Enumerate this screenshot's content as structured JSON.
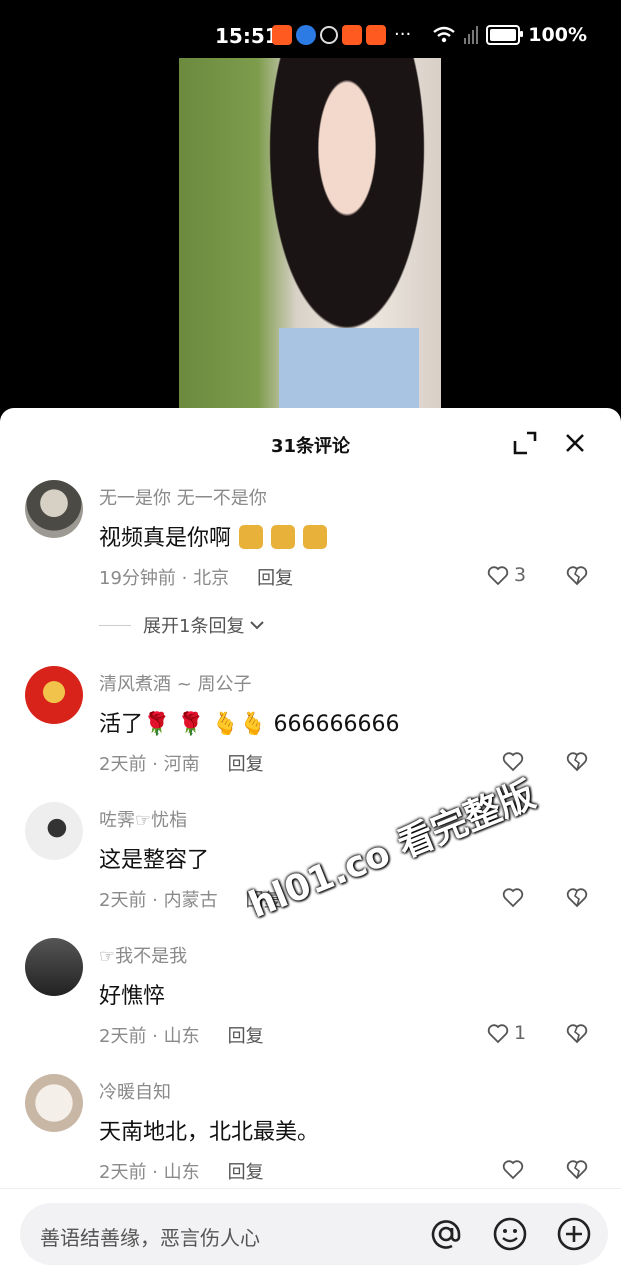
{
  "status_bar": {
    "time": "15:51",
    "more": "···",
    "battery_percent": "100%"
  },
  "panel": {
    "title": "31条评论"
  },
  "comments": [
    {
      "user": "无一是你 无一不是你",
      "text": "视频真是你啊",
      "time": "19分钟前 · 北京",
      "reply_label": "回复",
      "likes": "3",
      "emoji_count": 3
    },
    {
      "user": "清风煮酒 ~ 周公子",
      "text": "活了🌹 🌹 🫰🫰 666666666",
      "time": "2天前 · 河南",
      "reply_label": "回复",
      "likes": ""
    },
    {
      "user": "咗霁☞忧栺",
      "text": "这是整容了",
      "time": "2天前 · 内蒙古",
      "reply_label": "回复",
      "likes": ""
    },
    {
      "user": "☞我不是我",
      "text": "好憔悴",
      "time": "2天前 · 山东",
      "reply_label": "回复",
      "likes": "1"
    },
    {
      "user": "冷暖自知",
      "text": "天南地北，北北最美。",
      "time": "2天前 · 山东",
      "reply_label": "回复",
      "likes": ""
    }
  ],
  "expand_replies": "展开1条回复",
  "watermark": "hl01.co 看完整版",
  "input": {
    "placeholder": "善语结善缘，恶言伤人心"
  },
  "colors": {
    "accent_orange": "#ff5a1f",
    "meta_gray": "#8a8a8a"
  }
}
